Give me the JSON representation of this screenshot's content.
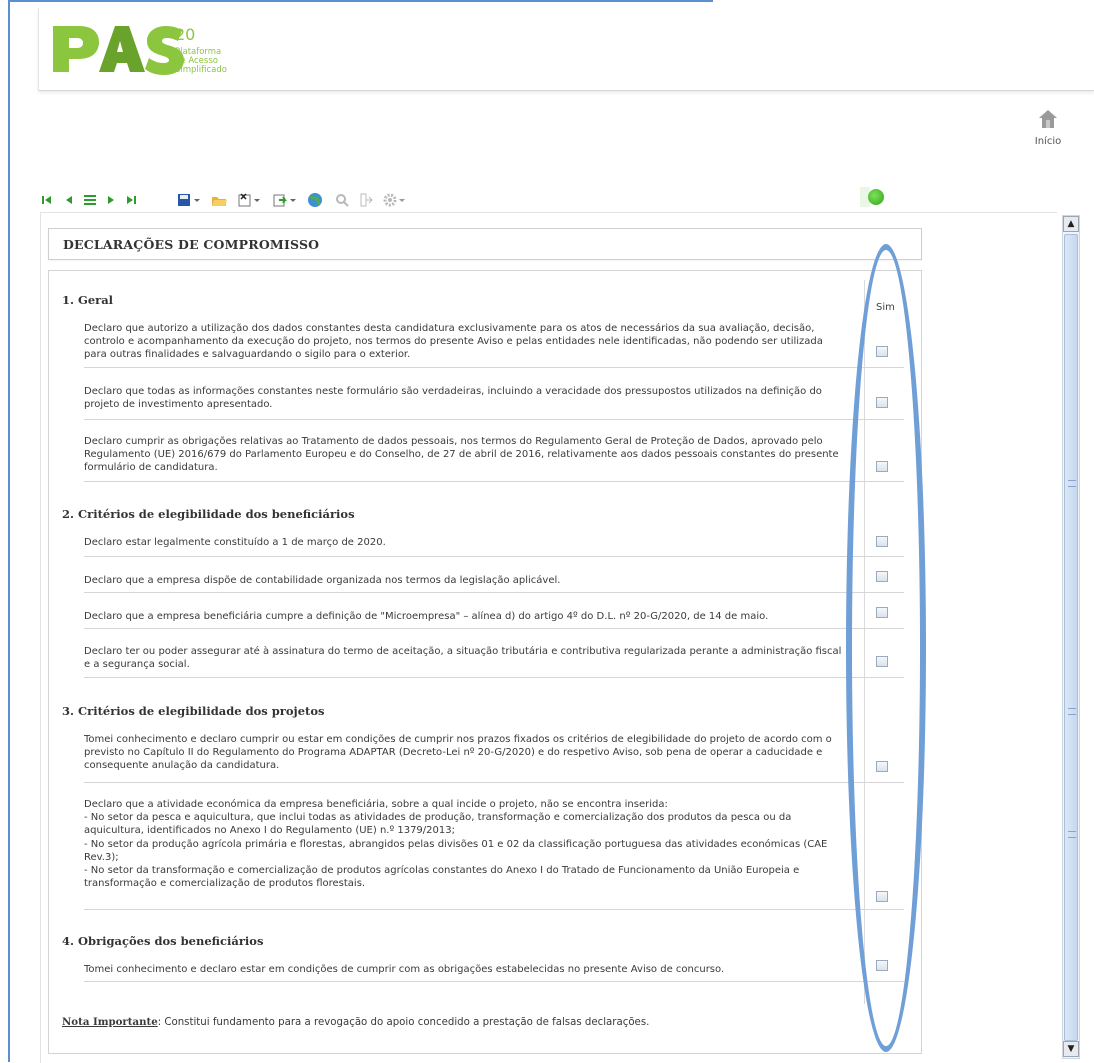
{
  "logo": {
    "letters": "PAS",
    "number": "20",
    "line1": "Plataforma",
    "line2": "de Acesso",
    "line3": "Simplificado"
  },
  "home": {
    "label": "Início"
  },
  "toolbar": {
    "icons": [
      "first-record-icon",
      "previous-record-icon",
      "list-icon",
      "next-record-icon",
      "last-record-icon",
      "save-icon",
      "open-folder-icon",
      "delete-icon",
      "export-icon",
      "globe-icon",
      "search-icon",
      "exit-icon",
      "settings-icon"
    ]
  },
  "title": "DECLARAÇÕES DE COMPROMISSO",
  "column_header": "Sim",
  "sections": [
    {
      "title": "1. Geral",
      "items": [
        "Declaro que autorizo a utilização dos dados constantes desta candidatura exclusivamente para os atos de necessários da sua avaliação, decisão, controlo e acompanhamento da execução do projeto, nos termos do presente Aviso e pelas entidades nele identificadas, não podendo ser utilizada para outras finalidades e salvaguardando o sigilo para o exterior.",
        "Declaro que todas as informações constantes neste formulário são verdadeiras, incluindo a veracidade dos pressupostos utilizados na definição do projeto de investimento apresentado.",
        "Declaro cumprir as obrigações relativas ao Tratamento de dados pessoais, nos termos do Regulamento Geral de Proteção de Dados, aprovado pelo Regulamento (UE) 2016/679 do Parlamento Europeu e do Conselho, de 27 de abril de 2016, relativamente aos dados pessoais constantes do presente formulário de candidatura."
      ]
    },
    {
      "title": "2. Critérios de elegibilidade dos beneficiários",
      "items": [
        "Declaro estar legalmente constituído a 1 de março de 2020.",
        "Declaro que a empresa dispõe de contabilidade organizada nos termos da legislação aplicável.",
        "Declaro que a empresa beneficiária cumpre a definição de \"Microempresa\" – alínea d) do artigo 4º do D.L. nº 20-G/2020, de 14 de maio.",
        "Declaro ter ou poder assegurar até à assinatura do termo de aceitação, a situação tributária e contributiva regularizada perante a administração fiscal e a segurança social."
      ]
    },
    {
      "title": "3. Critérios de elegibilidade dos projetos",
      "items": [
        "Tomei conhecimento e declaro cumprir ou estar em condições de cumprir nos prazos fixados os critérios de elegibilidade do projeto de acordo com o previsto no Capítulo II do Regulamento do Programa ADAPTAR (Decreto-Lei nº 20-G/2020) e do respetivo Aviso, sob pena de operar a caducidade e consequente anulação da candidatura.",
        "Declaro que a atividade económica da empresa beneficiária, sobre a qual incide o projeto, não se encontra inserida:\n- No setor da pesca e aquicultura, que inclui todas as atividades de produção, transformação e comercialização dos produtos da pesca ou da aquicultura, identificados no Anexo I do Regulamento (UE) n.º 1379/2013;\n- No setor da produção agrícola primária e florestas, abrangidos pelas divisões 01 e 02 da classificação portuguesa das atividades económicas (CAE Rev.3);\n- No setor da transformação e comercialização de produtos agrícolas constantes do Anexo I do Tratado de Funcionamento da União Europeia e transformação e comercialização de produtos florestais."
      ]
    },
    {
      "title": "4. Obrigações dos beneficiários",
      "items": [
        "Tomei conhecimento e declaro estar em condições de cumprir com as obrigações estabelecidas no presente Aviso de concurso."
      ]
    }
  ],
  "nota": {
    "label": "Nota Importante",
    "text": ": Constitui fundamento para a revogação do apoio concedido a prestação de falsas declarações."
  },
  "colors": {
    "accent": "#8cc63f",
    "highlight_oval": "#6f9fd6"
  }
}
